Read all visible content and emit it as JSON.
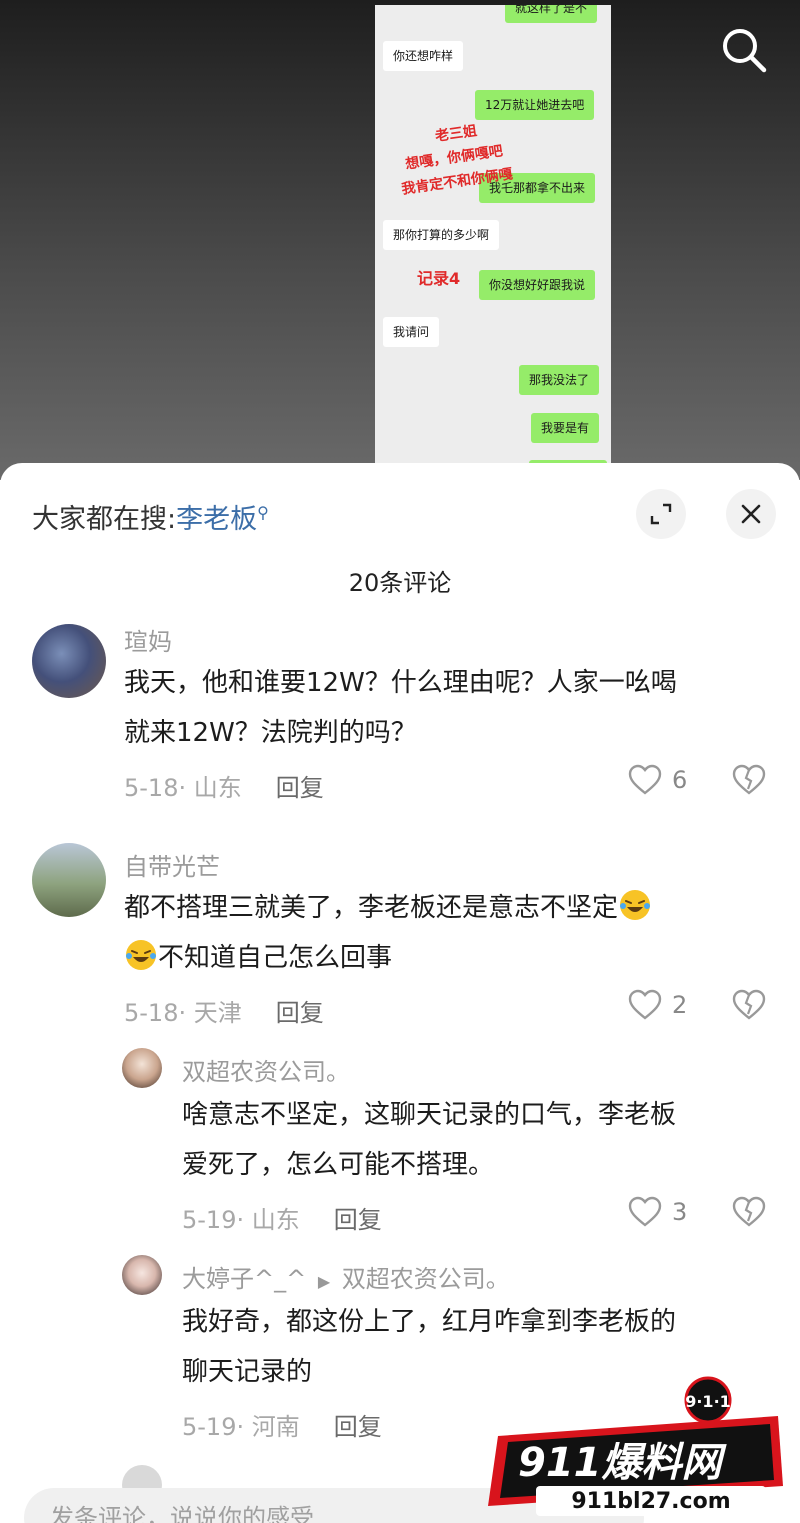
{
  "video": {
    "chat": [
      {
        "side": "out",
        "text": "就这样了是不"
      },
      {
        "side": "in",
        "text": "你还想咋样"
      },
      {
        "side": "out",
        "text": "12万就让她进去吧"
      },
      {
        "side": "out",
        "text": "我乇那都拿不出来"
      },
      {
        "side": "in",
        "text": "那你打算的多少啊"
      },
      {
        "side": "out",
        "text": "你没想好好跟我说"
      },
      {
        "side": "in",
        "text": "我请问"
      },
      {
        "side": "out",
        "text": "那我没法了"
      },
      {
        "side": "out",
        "text": "我要是有"
      }
    ],
    "annotation_lines": [
      "老三姐",
      "想嘎，你俩嘎吧",
      "我肯定不和你俩嘎"
    ],
    "record_label": "记录4"
  },
  "sheet": {
    "trending_prefix": "大家都在搜:",
    "trending_keyword": "李老板",
    "comment_count_title": "20条评论",
    "reply_label": "回复",
    "comments": [
      {
        "user": "瑄妈",
        "text_line1": "我天，他和谁要12W？什么理由呢？人家一吆喝",
        "text_line2": "就来12W？法院判的吗？",
        "date_loc": "5-18· 山东",
        "likes": "6"
      },
      {
        "user": "自带光芒",
        "text_line1": "都不搭理三就美了，李老板还是意志不坚定",
        "text_line2": "不知道自己怎么回事",
        "date_loc": "5-18· 天津",
        "likes": "2"
      },
      {
        "user": "双超农资公司。",
        "text_line1": "啥意志不坚定，这聊天记录的口气，李老板",
        "text_line2": "爱死了，怎么可能不搭理。",
        "date_loc": "5-19· 山东",
        "likes": "3"
      },
      {
        "user": "大婷子^_^",
        "reply_to": "双超农资公司。",
        "text_line1": "我好奇，都这份上了，红月咋拿到李老板的",
        "text_line2": "聊天记录的",
        "date_loc": "5-19· 河南"
      }
    ],
    "input_placeholder": "发条评论，说说你的感受"
  },
  "watermark": {
    "badge": "9·1·1",
    "brand": "911爆料网",
    "url": "911bl27.com"
  }
}
